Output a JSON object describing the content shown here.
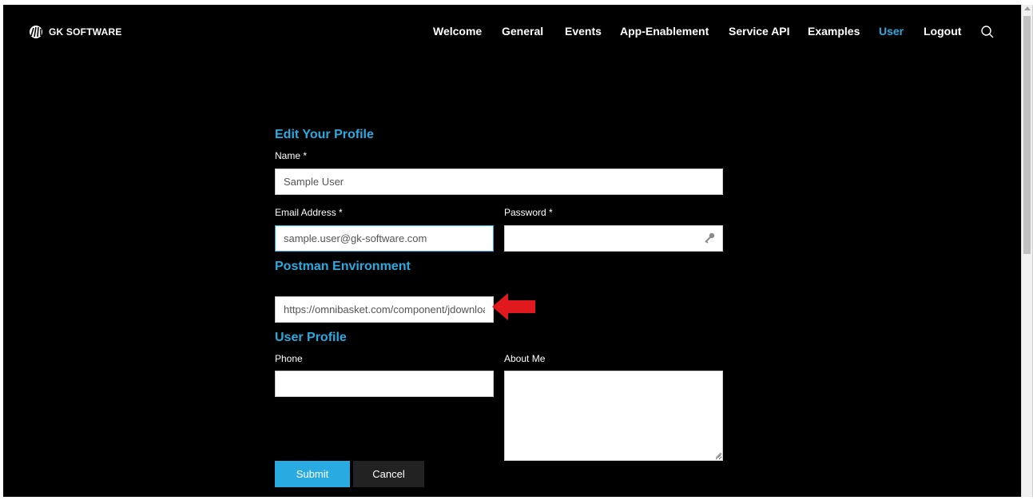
{
  "brand": {
    "name": "GK SOFTWARE"
  },
  "nav": {
    "items": [
      {
        "label": "Welcome",
        "active": false
      },
      {
        "label": "General",
        "active": false
      },
      {
        "label": "Events",
        "active": false
      },
      {
        "label": "App-Enablement",
        "active": false
      },
      {
        "label": "Service API",
        "active": false
      },
      {
        "label": "Examples",
        "active": false
      },
      {
        "label": "User",
        "active": true
      },
      {
        "label": "Logout",
        "active": false
      }
    ],
    "search_icon": "search-icon"
  },
  "form": {
    "title": "Edit Your Profile",
    "name": {
      "label": "Name *",
      "value": "Sample User"
    },
    "email": {
      "label": "Email Address *",
      "value": "sample.user@gk-software.com"
    },
    "password": {
      "label": "Password *",
      "value": "",
      "icon": "key-icon"
    },
    "postman_section": "Postman Environment",
    "postman_url": {
      "value": "https://omnibasket.com/component/jdownloads"
    },
    "user_profile_section": "User Profile",
    "phone": {
      "label": "Phone",
      "value": ""
    },
    "about": {
      "label": "About Me",
      "value": ""
    },
    "submit_label": "Submit",
    "cancel_label": "Cancel"
  },
  "colors": {
    "accent": "#29abe2",
    "background": "#000000",
    "annotation_arrow": "#e0191f"
  }
}
